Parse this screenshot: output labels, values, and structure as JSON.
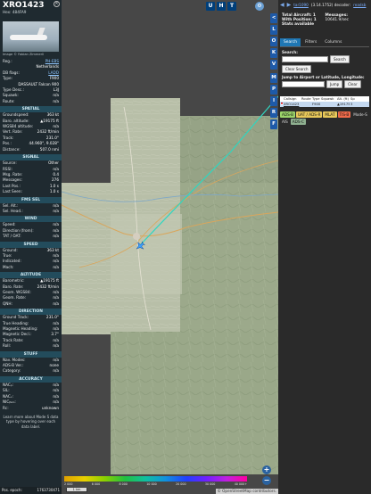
{
  "aircraft": {
    "callsign": "XRO1423",
    "hex_label": "Hex:",
    "hex": "484FA9",
    "photo_credit": "Image © Fabian Zimmerli"
  },
  "details": [
    {
      "label": "Reg.:",
      "value": "PH-EBS",
      "style": "blue"
    },
    {
      "label": "",
      "value": "Netherlands",
      "style": ""
    },
    {
      "label": "DB flags:",
      "value": "LADD",
      "style": "blue"
    },
    {
      "label": "Type:",
      "value": "F900",
      "style": ""
    },
    {
      "label": "",
      "value": "DASSAULT Falcon 900",
      "style": ""
    },
    {
      "label": "Type Desc.:",
      "value": "L3J",
      "style": ""
    },
    {
      "label": "Squawk:",
      "value": "n/a",
      "style": ""
    },
    {
      "label": "Route:",
      "value": "n/a",
      "style": ""
    }
  ],
  "sections": [
    {
      "title": "SPATIAL",
      "rows": [
        {
          "label": "Groundspeed:",
          "value": "363 kt"
        },
        {
          "label": "Baro. altitude:",
          "value": "▲19175 ft"
        },
        {
          "label": "WGS84 altitude:",
          "value": "n/a"
        },
        {
          "label": "Vert. Rate:",
          "value": "2432 ft/min"
        },
        {
          "label": "Track:",
          "value": "231.0°"
        },
        {
          "label": "Pos.:",
          "value": "44.960°, 9.028°"
        },
        {
          "label": "Distance:",
          "value": "507.0 nmi"
        }
      ]
    },
    {
      "title": "SIGNAL",
      "rows": [
        {
          "label": "Source:",
          "value": "Other"
        },
        {
          "label": "RSSI:",
          "value": "n/a"
        },
        {
          "label": "Msg. Rate:",
          "value": "0.4"
        },
        {
          "label": "Messages:",
          "value": "276"
        },
        {
          "label": "Last Pos.:",
          "value": "1.0 s"
        },
        {
          "label": "Last Seen:",
          "value": "1.0 s"
        }
      ]
    },
    {
      "title": "FMS SEL",
      "rows": [
        {
          "label": "Sel. Alt.:",
          "value": "n/a"
        },
        {
          "label": "Sel. Head.:",
          "value": "n/a"
        }
      ]
    },
    {
      "title": "WIND",
      "rows": [
        {
          "label": "Speed:",
          "value": "n/a"
        },
        {
          "label": "Direction (from):",
          "value": "n/a"
        },
        {
          "label": "TAT / OAT:",
          "value": "n/a"
        }
      ]
    },
    {
      "title": "SPEED",
      "rows": [
        {
          "label": "Ground:",
          "value": "363 kt"
        },
        {
          "label": "True:",
          "value": "n/a"
        },
        {
          "label": "Indicated:",
          "value": "n/a"
        },
        {
          "label": "Mach:",
          "value": "n/a"
        }
      ]
    },
    {
      "title": "ALTITUDE",
      "rows": [
        {
          "label": "Barometric:",
          "value": "▲19175 ft"
        },
        {
          "label": "Baro. Rate:",
          "value": "2432 ft/min"
        },
        {
          "label": "Geom. WGS84:",
          "value": "n/a"
        },
        {
          "label": "Geom. Rate:",
          "value": "n/a"
        },
        {
          "label": "QNH:",
          "value": "n/a"
        }
      ]
    },
    {
      "title": "DIRECTION",
      "rows": [
        {
          "label": "Ground Track:",
          "value": "231.0°"
        },
        {
          "label": "True Heading:",
          "value": "n/a"
        },
        {
          "label": "Magnetic Heading:",
          "value": "n/a"
        },
        {
          "label": "Magnetic Decl.:",
          "value": "3.7°"
        },
        {
          "label": "Track Rate:",
          "value": "n/a"
        },
        {
          "label": "Roll:",
          "value": "n/a"
        }
      ]
    },
    {
      "title": "STUFF",
      "rows": [
        {
          "label": "Nav. Modes:",
          "value": "n/a"
        },
        {
          "label": "ADS-B Ver.:",
          "value": "none"
        },
        {
          "label": "Category:",
          "value": "n/a"
        }
      ]
    },
    {
      "title": "ACCURACY",
      "rows": [
        {
          "label": "NACₚ:",
          "value": "n/a"
        },
        {
          "label": "SIL:",
          "value": "n/a"
        },
        {
          "label": "NACᵥ:",
          "value": "n/a"
        },
        {
          "label": "NICᵦₐᵣₒ:",
          "value": "n/a"
        },
        {
          "label": "Rc:",
          "value": "unknown"
        }
      ]
    }
  ],
  "learn_more": "Learn more about Mode S data type by hovering over each data label.",
  "pos_epoch": {
    "label": "Pos. epoch:",
    "value": "1763730471"
  },
  "map": {
    "top_buttons": [
      "U",
      "H",
      "T"
    ],
    "side_buttons": [
      "L",
      "O",
      "K",
      "V",
      "M",
      "P",
      "I",
      "R",
      "F"
    ],
    "legend_labels": [
      "2 000",
      "6 000",
      "8 000",
      "10 000",
      "20 000",
      "30 000",
      "40 000+"
    ],
    "scale_label": "1 km",
    "attribution": "© OpenStreetMap contributors.",
    "zoom_in": "+",
    "zoom_out": "−"
  },
  "right": {
    "version_link": "tar1090",
    "version_text": "(3.14.1752) decoder:",
    "decoder_link": "readsb",
    "total_aircraft": "Total Aircraft: 1",
    "with_position": "With Position: 1",
    "stats_available": "Stats available",
    "messages": "Messages:",
    "messages_rate": "10641.9/sec",
    "tabs": [
      "Search",
      "Filters",
      "Columns"
    ],
    "search_label": "Search:",
    "search_button": "Search",
    "clear_search": "Clear Search",
    "jump_label": "Jump to Airport or Latitude, Longitude:",
    "jump_button": "Jump",
    "clear_button": "Clear",
    "table_headers": [
      "",
      "Callsign",
      "Route",
      "Type",
      "Squawk",
      "Alt. (ft)",
      "Sp"
    ],
    "table_row": [
      "",
      "XRO1423",
      "",
      "F900",
      "",
      "▲19175",
      "3"
    ],
    "filter_badges": [
      {
        "label": "ADS-B",
        "style": "g"
      },
      {
        "label": "UAT / ADS-R",
        "style": "y"
      },
      {
        "label": "MLAT",
        "style": "y"
      },
      {
        "label": "TIS-B",
        "style": "o"
      },
      {
        "label": "Mode-S",
        "style": "dk"
      },
      {
        "label": "AIS",
        "style": "dk"
      },
      {
        "label": "ADS-C",
        "style": "gr"
      }
    ]
  },
  "colors": {
    "accent": "#1f77b4",
    "panel": "#1f2a30",
    "section": "#234c5c",
    "track": "#2fd6c0"
  }
}
